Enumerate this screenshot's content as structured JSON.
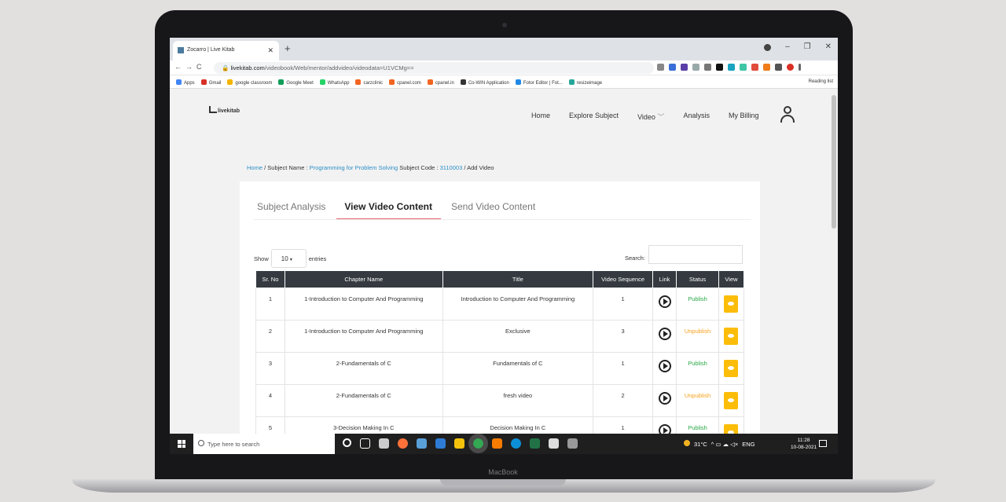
{
  "device": {
    "brand": "MacBook"
  },
  "browser": {
    "tab_title": "Zocarro | Live Kitab",
    "url_domain": "livekitab.com",
    "url_path": "/videobook/Web/mentor/addvideo/videodata=U1VCMg==",
    "bookmarks": [
      "Apps",
      "Gmail",
      "google classroom",
      "Google Meet",
      "WhatsApp",
      "carzclinic",
      "cpanel.com",
      "cpanel.in",
      "Co-WIN Application",
      "Fotor Editor | Fot...",
      "resizeimage"
    ],
    "reading_list": "Reading list",
    "colors": {
      "tabbar": "#dee1e6"
    }
  },
  "site": {
    "logo": "livekitab",
    "nav": [
      "Home",
      "Explore Subject",
      "Video",
      "Analysis",
      "My Billing"
    ]
  },
  "breadcrumb": {
    "home": "Home",
    "sep1": "/ Subject Name :",
    "subject": "Programming for Problem Solving",
    "code_label": "Subject Code :",
    "code": "3110003",
    "current": "/ Add Video"
  },
  "tabs": [
    "Subject Analysis",
    "View Video Content",
    "Send Video Content"
  ],
  "active_tab": "View Video Content",
  "controls": {
    "show": "Show",
    "entries_value": "10",
    "entries": "entries",
    "search": "Search:"
  },
  "table": {
    "headers": [
      "Sr. No",
      "Chapter Name",
      "Title",
      "Video Sequence",
      "Link",
      "Status",
      "View"
    ],
    "rows": [
      {
        "sr": "1",
        "chapter": "1-Introduction to Computer And Programming",
        "title": "Introduction to Computer And Programming",
        "seq": "1",
        "status": "Publish"
      },
      {
        "sr": "2",
        "chapter": "1-Introduction to Computer And Programming",
        "title": "Exclusive",
        "seq": "3",
        "status": "Unpublish"
      },
      {
        "sr": "3",
        "chapter": "2-Fundamentals of C",
        "title": "Fundamentals of C",
        "seq": "1",
        "status": "Publish"
      },
      {
        "sr": "4",
        "chapter": "2-Fundamentals of C",
        "title": "fresh video",
        "seq": "2",
        "status": "Unpublish"
      },
      {
        "sr": "5",
        "chapter": "3-Decision Making In C",
        "title": "Decision Making In C",
        "seq": "1",
        "status": "Publish"
      }
    ],
    "colors": {
      "header": "#343a40",
      "publish": "#28a745",
      "unpublish": "#f7a11a",
      "view": "#fbbd08"
    }
  },
  "taskbar": {
    "search_placeholder": "Type here to search",
    "weather": "31°C",
    "lang": "ENG",
    "time": "11:28",
    "date": "10-08-2021"
  }
}
